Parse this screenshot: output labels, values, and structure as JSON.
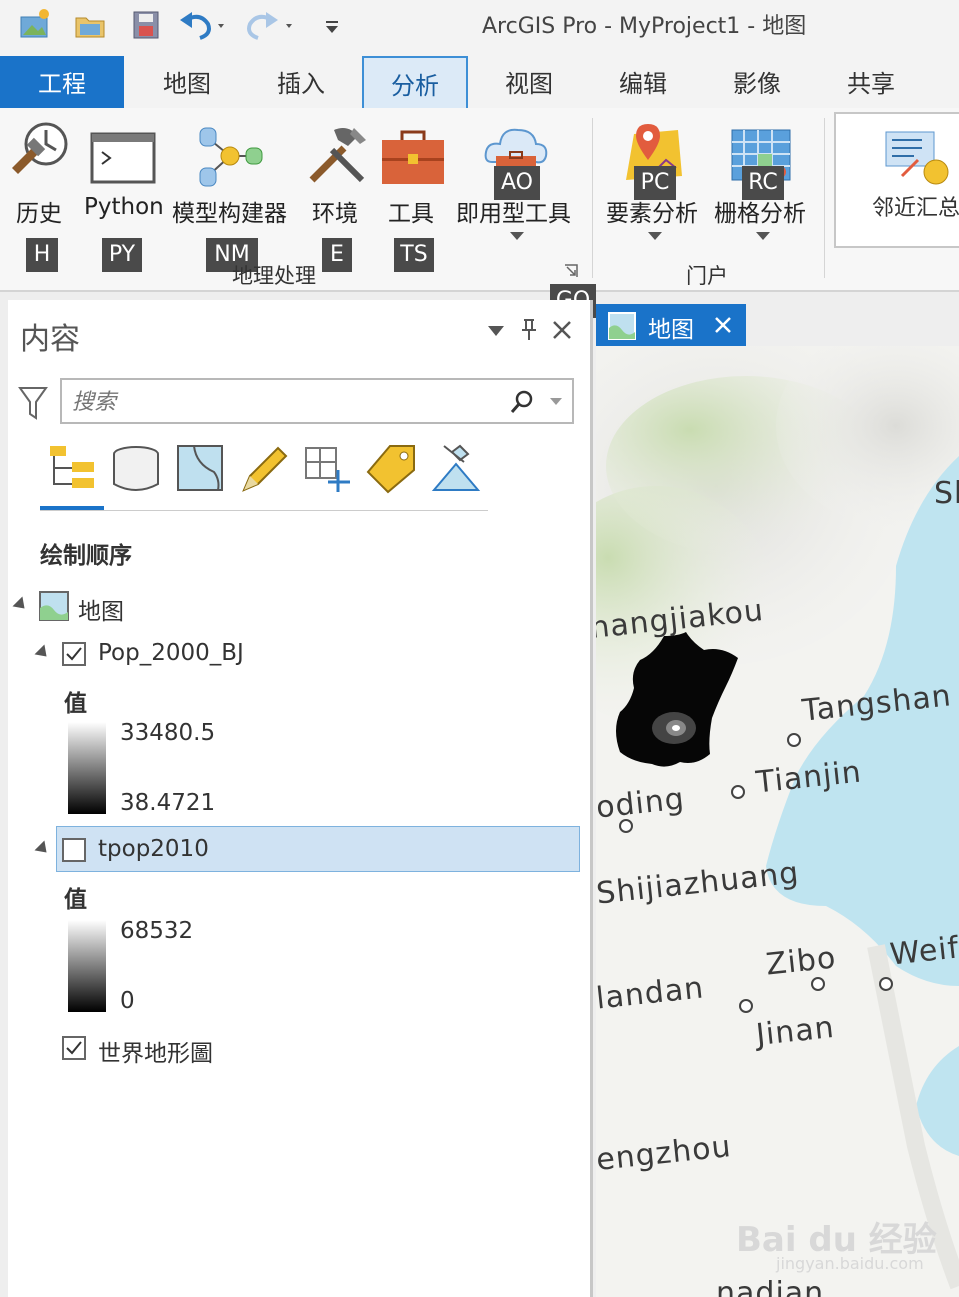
{
  "window": {
    "title": "ArcGIS Pro - MyProject1 - 地图"
  },
  "quick_access": {
    "icons": [
      "new-project-icon",
      "open-project-icon",
      "save-project-icon",
      "undo-icon",
      "redo-icon",
      "customize-icon"
    ]
  },
  "tabs": [
    {
      "label": "工程"
    },
    {
      "label": "地图"
    },
    {
      "label": "插入"
    },
    {
      "label": "分析"
    },
    {
      "label": "视图"
    },
    {
      "label": "编辑"
    },
    {
      "label": "影像"
    },
    {
      "label": "共享"
    }
  ],
  "ribbon": {
    "geoprocessing": {
      "group_label": "地理处理",
      "buttons": [
        {
          "label": "历史",
          "keytip": "H"
        },
        {
          "label": "Python",
          "keytip": "PY"
        },
        {
          "label": "模型构建器",
          "keytip": "NM"
        },
        {
          "label": "环境",
          "keytip": "E"
        },
        {
          "label": "工具",
          "keytip": "TS"
        },
        {
          "label": "即用型工具",
          "keytip": "AO"
        }
      ],
      "launcher_keytip": "GO"
    },
    "portal": {
      "group_label": "门户",
      "buttons": [
        {
          "label": "要素分析",
          "keytip": "PC"
        },
        {
          "label": "栅格分析",
          "keytip": "RC"
        }
      ]
    },
    "gallery": {
      "label": "邻近汇总"
    }
  },
  "contents": {
    "title": "内容",
    "search_placeholder": "搜索",
    "section_title": "绘制顺序",
    "map_name": "地图",
    "layers": [
      {
        "name": "Pop_2000_BJ",
        "checked": true,
        "legend_title": "值",
        "max": "33480.5",
        "min": "38.4721"
      },
      {
        "name": "tpop2010",
        "checked": false,
        "selected": true,
        "legend_title": "值",
        "max": "68532",
        "min": "0"
      },
      {
        "name": "世界地形圖",
        "checked": true
      }
    ]
  },
  "map_view": {
    "tab_label": "地图",
    "labels": [
      "hangjiakou",
      "Tangshan",
      "Tianjin",
      "oding",
      "Shijiazhuang",
      "Zibo",
      "Weif",
      "landan",
      "Jinan",
      "engzhou",
      "Sh",
      "nadian"
    ],
    "watermark": "Bai du 经验",
    "watermark_url": "jingyan.baidu.com"
  },
  "colors": {
    "accent": "#1a73c9",
    "selected_row": "#cfe2f3"
  }
}
